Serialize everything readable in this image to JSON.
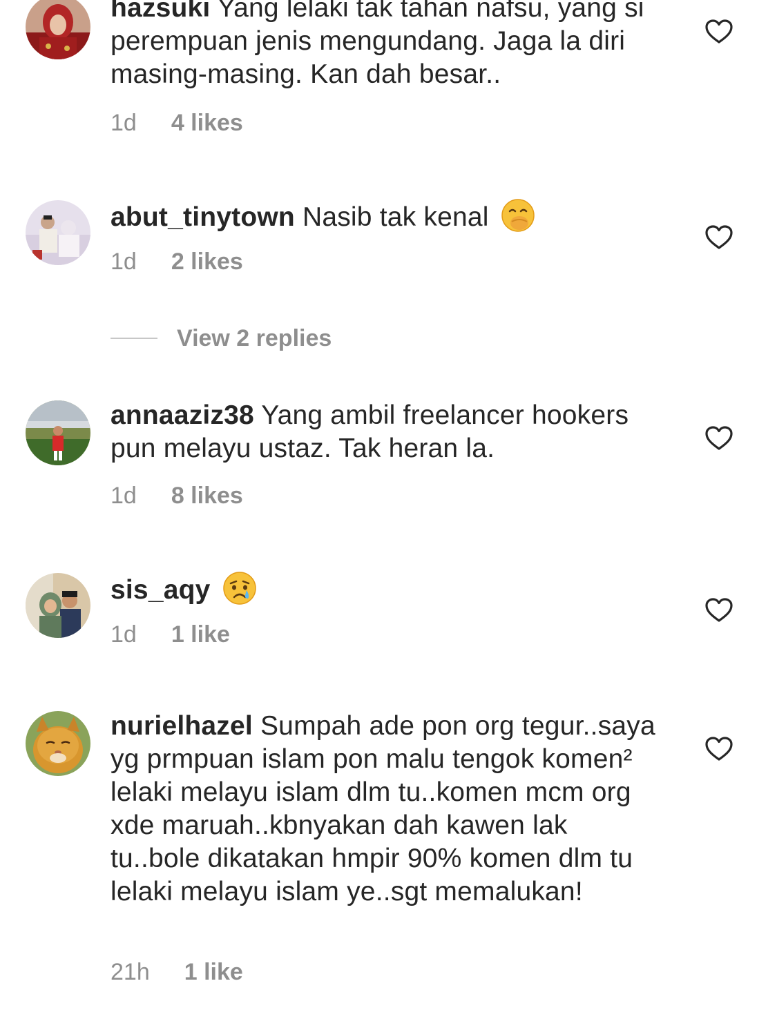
{
  "comments": [
    {
      "username": "hazsuki",
      "text": "Yang lelaki tak tahan nafsu, yang si perempuan jenis mengundang. Jaga la diri masing-masing. Kan dah besar..",
      "time": "1d",
      "likes": "4 likes"
    },
    {
      "username": "abut_tinytown",
      "text": "Nasib tak kenal",
      "emoji": "face-with-hand-over-mouth-emoji",
      "time": "1d",
      "likes": "2 likes"
    },
    {
      "username": "annaaziz38",
      "text": "Yang ambil freelancer hookers pun melayu ustaz. Tak heran la.",
      "time": "1d",
      "likes": "8 likes"
    },
    {
      "username": "sis_aqy",
      "text": "",
      "emoji": "crying-face-emoji",
      "time": "1d",
      "likes": "1 like"
    },
    {
      "username": "nurielhazel",
      "text": "Sumpah ade pon org tegur..saya yg prmpuan islam pon malu tengok komen² lelaki melayu islam dlm tu..komen mcm org xde maruah..kbnyakan dah kawen lak tu..bole dikatakan hmpir 90% komen dlm tu lelaki melayu islam ye..sgt memalukan!",
      "time": "21h",
      "likes": "1 like"
    }
  ],
  "view_replies": {
    "label": "View 2 replies"
  },
  "icons": {
    "like": "heart-outline-icon"
  },
  "colors": {
    "text_primary": "#262626",
    "text_secondary": "#8e8e8e",
    "divider": "#c7c7c7",
    "background": "#ffffff"
  }
}
